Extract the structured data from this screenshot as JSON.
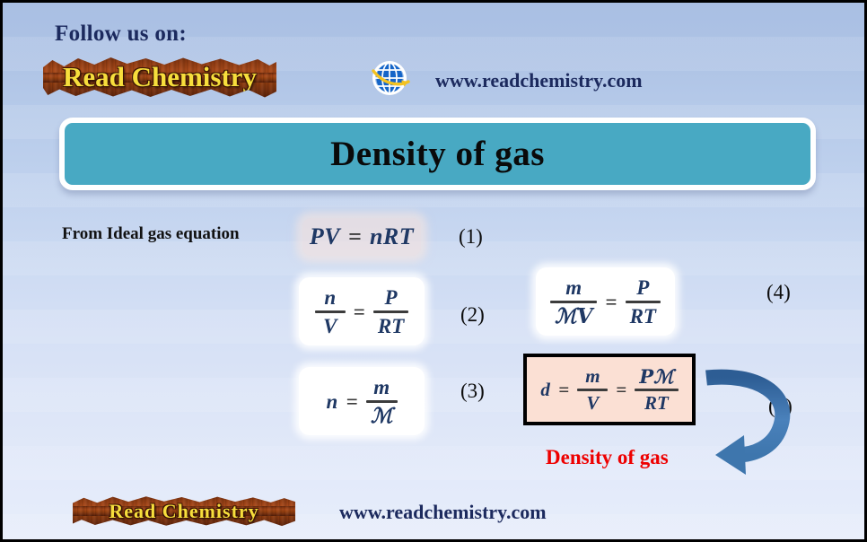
{
  "page": {
    "background_top_color": "#a9bfe3",
    "background_bottom_color": "#e7edfb",
    "border_color": "#000000"
  },
  "header": {
    "follow_label": "Follow us on:",
    "logo_text": "Read Chemistry",
    "globe_icon": "globe-icon",
    "site_url": "www.readchemistry.com",
    "logo_wood_color": "#8f3b12",
    "logo_text_color": "#f7de3c",
    "url_color": "#1c2a5e"
  },
  "title": {
    "text": "Density of  gas",
    "banner_color": "#48a9c3",
    "border_color": "#ffffff",
    "text_color": "#0a0a0a"
  },
  "content": {
    "from_label": "From Ideal gas equation",
    "density_caption": "Density of  gas",
    "density_caption_color": "#ee0000",
    "arrow_color": "#3e76ad",
    "highlight_box_color": "#fbe0d4",
    "numbers": {
      "one": "(1)",
      "two": "(2)",
      "three": "(3)",
      "four": "(4)",
      "five": "(5)"
    },
    "equations": [
      {
        "id": "eq1",
        "number": "(1)",
        "latex": "PV = nRT",
        "lhs": "PV",
        "operator": "=",
        "rhs": "nRT",
        "style": "soft-peach"
      },
      {
        "id": "eq2",
        "number": "(2)",
        "latex": "n/V = P/RT",
        "lhs_num": "n",
        "lhs_den": "V",
        "operator": "=",
        "rhs_num": "P",
        "rhs_den": "RT",
        "style": "white"
      },
      {
        "id": "eq3",
        "number": "(3)",
        "latex": "n = m/M",
        "lhs": "n",
        "operator": "=",
        "rhs_num": "m",
        "rhs_den": "ℳ",
        "style": "white"
      },
      {
        "id": "eq4",
        "number": "(4)",
        "latex": "m/(MV) = P/RT",
        "lhs_num": "m",
        "lhs_den": "ℳV",
        "operator": "=",
        "rhs_num": "P",
        "rhs_den": "RT",
        "style": "white"
      },
      {
        "id": "eq5",
        "number": "(5)",
        "latex": "d = m/V = PM/RT",
        "lhs": "d",
        "operator1": "=",
        "mid_num": "m",
        "mid_den": "V",
        "operator2": "=",
        "rhs_num": "Pℳ",
        "rhs_den": "RT",
        "style": "boxed-peach"
      }
    ],
    "symbols": {
      "m": "m",
      "V": "V",
      "n": "n",
      "P": "P",
      "R": "R",
      "T": "T",
      "d": "d",
      "M": "ℳ",
      "MV": "ℳV",
      "PM": "Pℳ",
      "RT": "RT",
      "nRT": "nRT",
      "PV": "PV",
      "equals": "="
    }
  },
  "footer": {
    "logo_text": "Read Chemistry",
    "site_url": "www.readchemistry.com"
  }
}
